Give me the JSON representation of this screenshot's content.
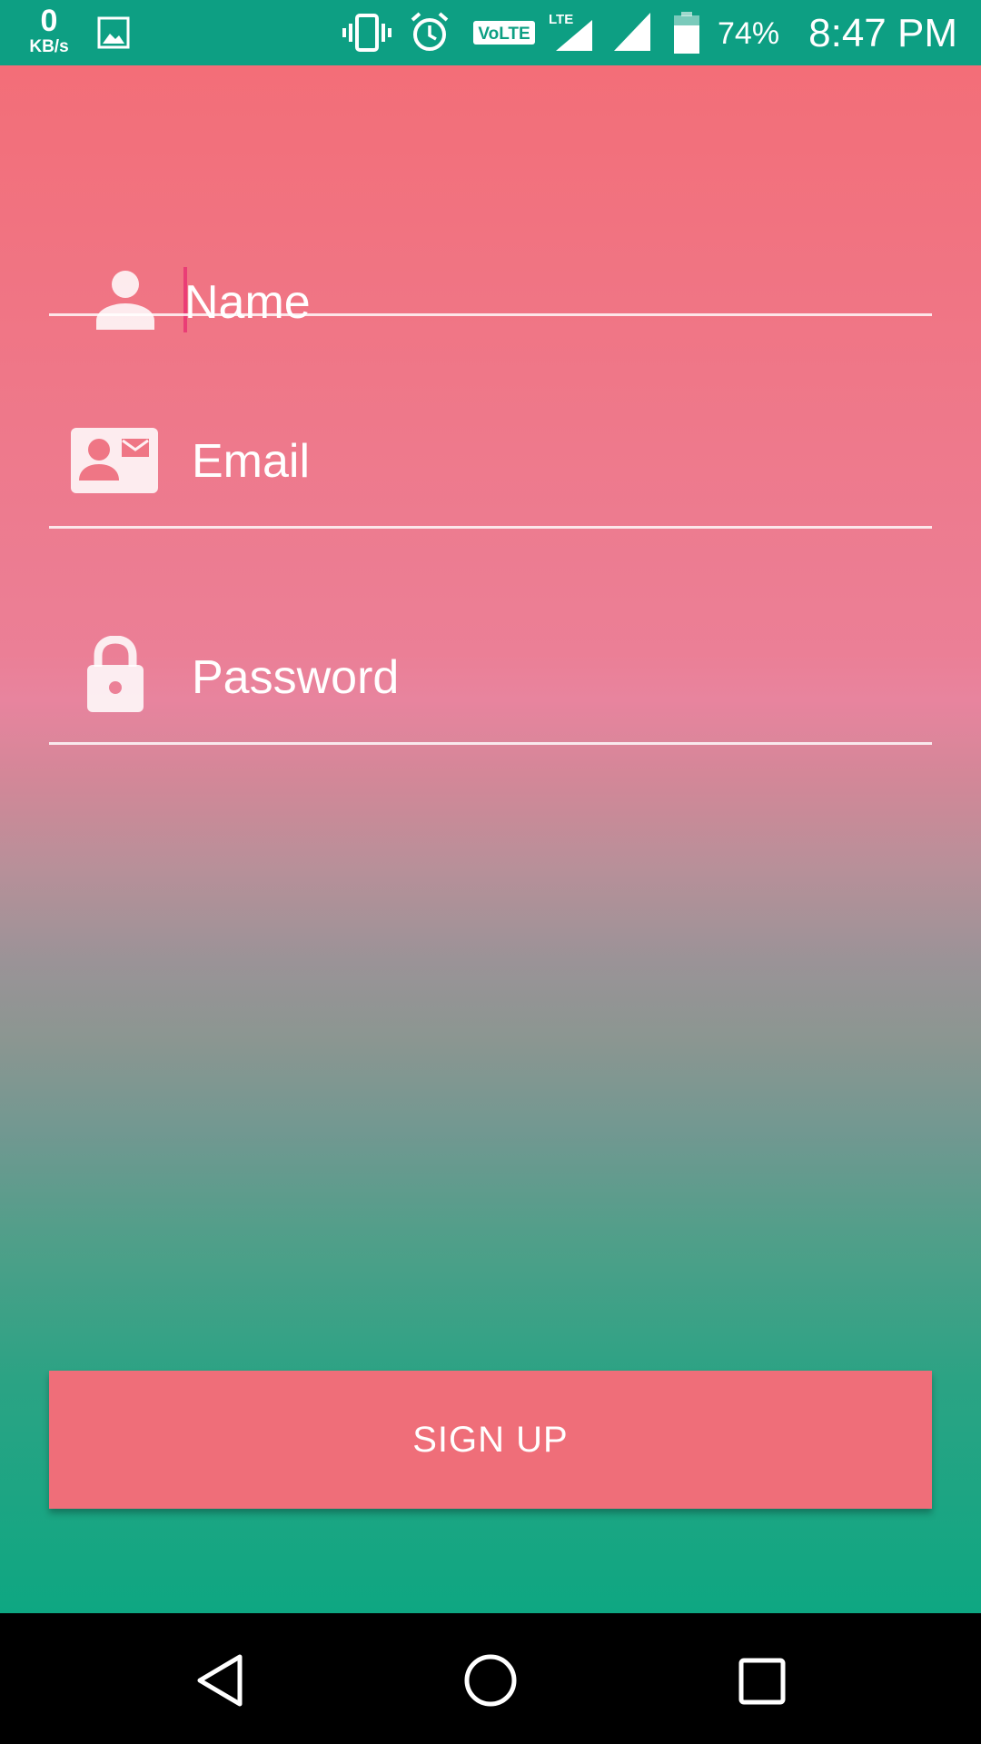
{
  "status_bar": {
    "net_speed_value": "0",
    "net_speed_unit": "KB/s",
    "battery_percent": "74%",
    "time": "8:47 PM",
    "volte_label": "VoLTE",
    "lte_label": "LTE",
    "icons": [
      "image-notification-icon",
      "vibrate-icon",
      "alarm-icon",
      "volte-icon",
      "lte-signal-icon",
      "signal-icon",
      "battery-icon"
    ]
  },
  "form": {
    "fields": [
      {
        "placeholder": "Name",
        "icon": "person-icon",
        "focused": true
      },
      {
        "placeholder": "Email",
        "icon": "contact-mail-icon",
        "focused": false
      },
      {
        "placeholder": "Password",
        "icon": "lock-icon",
        "focused": false
      }
    ],
    "submit_label": "SIGN UP"
  },
  "nav_bar": {
    "icons": [
      "back-icon",
      "home-icon",
      "recents-icon"
    ]
  },
  "colors": {
    "status_bar": "#0d9f83",
    "gradient_top": "#f36e78",
    "gradient_middle": "#e8849e",
    "gradient_bottom": "#0ea782",
    "button": "#ef6e79",
    "caret": "#ea3d76",
    "nav_bar": "#000000"
  }
}
